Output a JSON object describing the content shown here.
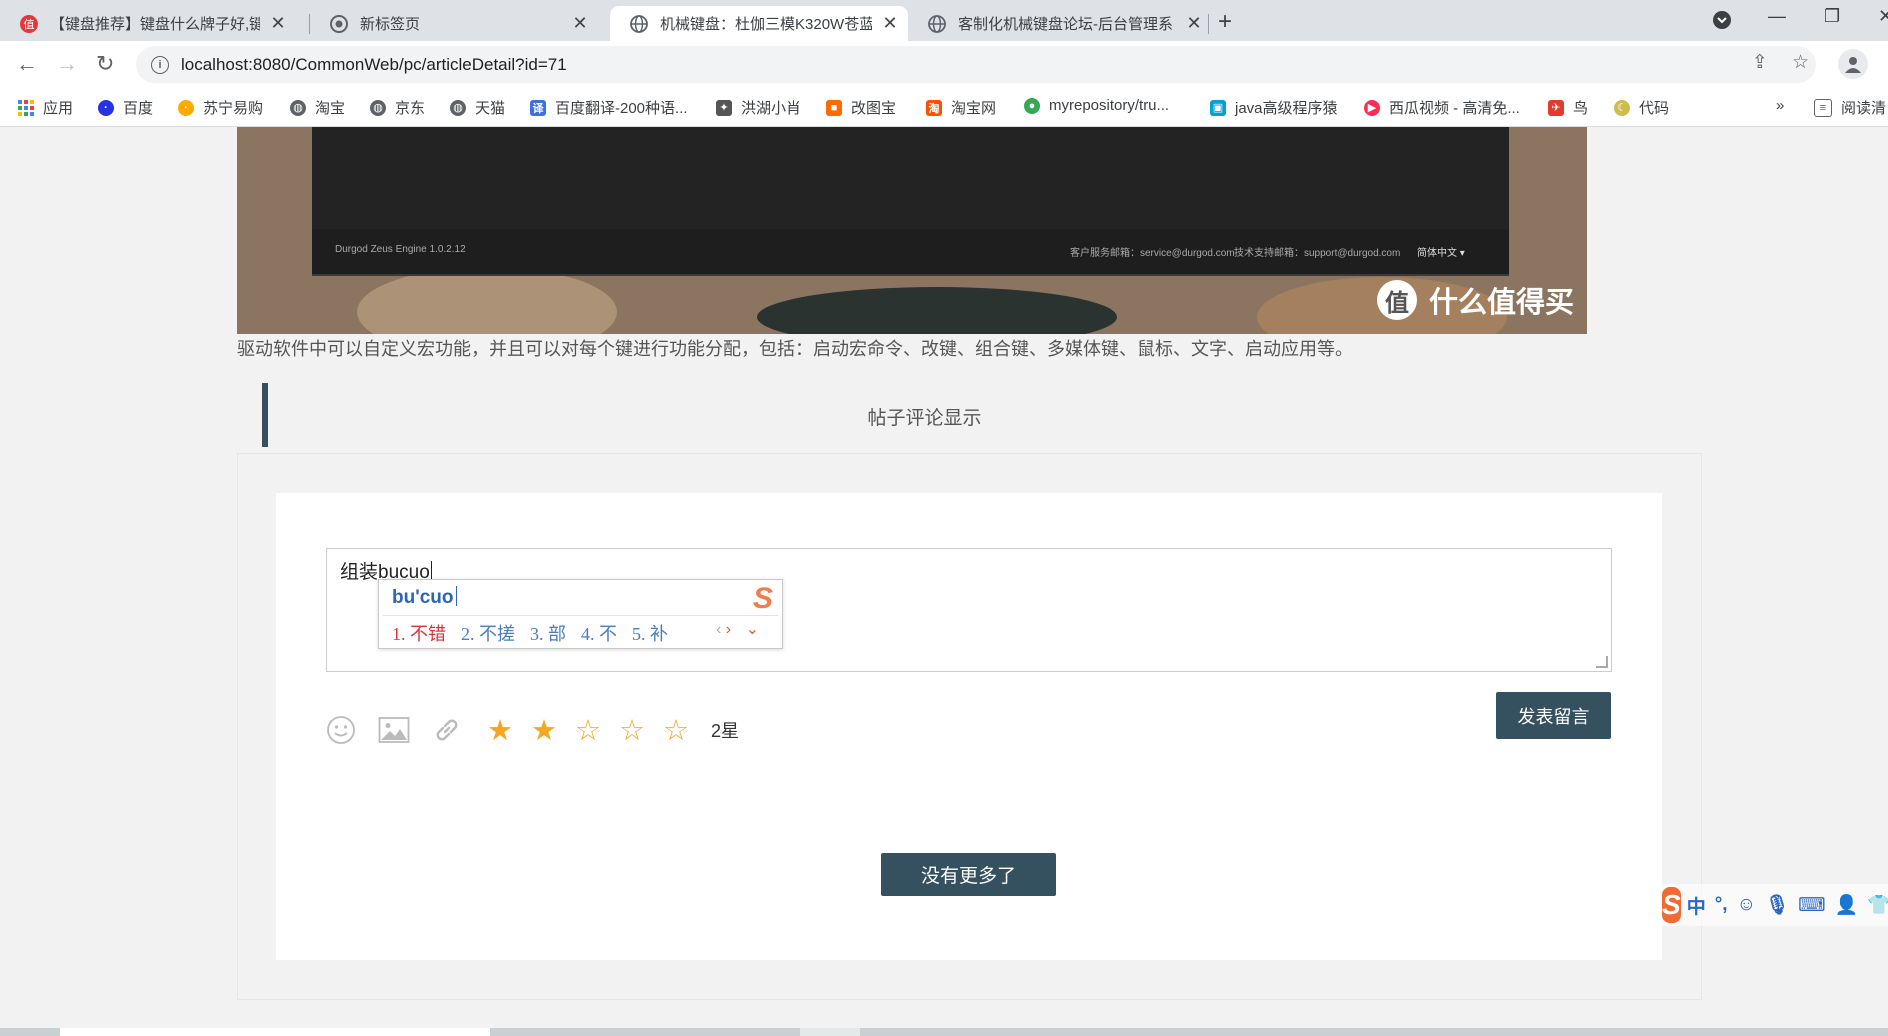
{
  "browser": {
    "tabs": [
      {
        "title": "【键盘推荐】键盘什么牌子好,键盘",
        "favicon": "smzdm-icon",
        "active": false
      },
      {
        "title": "新标签页",
        "favicon": "chrome-icon",
        "active": false
      },
      {
        "title": "机械键盘：杜伽三模K320W苍蓝",
        "favicon": "globe-icon",
        "active": true
      },
      {
        "title": "客制化机械键盘论坛-后台管理系",
        "favicon": "globe-icon",
        "active": false
      }
    ],
    "url": "localhost:8080/CommonWeb/pc/articleDetail?id=71",
    "bookmarks": [
      {
        "label": "应用",
        "icon": "apps-icon",
        "color": "#4285f4"
      },
      {
        "label": "百度",
        "icon": "baidu-icon",
        "color": "#2932e1"
      },
      {
        "label": "苏宁易购",
        "icon": "suning-icon",
        "color": "#ffaa00"
      },
      {
        "label": "淘宝",
        "icon": "globe-icon",
        "color": "#5f6368"
      },
      {
        "label": "京东",
        "icon": "globe-icon",
        "color": "#5f6368"
      },
      {
        "label": "天猫",
        "icon": "globe-icon",
        "color": "#5f6368"
      },
      {
        "label": "百度翻译-200种语...",
        "icon": "translate-icon",
        "color": "#3b6fe4"
      },
      {
        "label": "洪湖小肖",
        "icon": "bee-icon",
        "color": "#555555"
      },
      {
        "label": "改图宝",
        "icon": "gaitubao-icon",
        "color": "#ff6a00"
      },
      {
        "label": "淘宝网",
        "icon": "taobao-icon",
        "color": "#ff5000"
      },
      {
        "label": "myrepository/tru...",
        "icon": "chrome-icon",
        "color": "#34a853"
      },
      {
        "label": "java高级程序猿",
        "icon": "bilibili-icon",
        "color": "#00a1d6"
      },
      {
        "label": "西瓜视频 - 高清免...",
        "icon": "xigua-icon",
        "color": "#fe2c55"
      },
      {
        "label": "鸟",
        "icon": "bird-icon",
        "color": "#e33b2e"
      },
      {
        "label": "代码",
        "icon": "moon-icon",
        "color": "#cdbd4b"
      }
    ],
    "reading_list": "阅读清"
  },
  "article": {
    "image_footer": {
      "engine": "Durgod Zeus Engine 1.0.2.12",
      "service": "客户服务邮箱：service@durgod.com",
      "support": "技术支持邮箱：support@durgod.com",
      "language": "简体中文 ▾"
    },
    "watermark_badge": "值",
    "watermark_text": "什么值得买",
    "description": "驱动软件中可以自定义宏功能，并且可以对每个键进行功能分配，包括：启动宏命令、改键、组合键、多媒体键、鼠标、文字、启动应用等。"
  },
  "comments": {
    "section_title": "帖子评论显示",
    "draft_text": "组装bucuo",
    "ime": {
      "pinyin": "bu'cuo",
      "candidates": [
        "1. 不错",
        "2. 不搓",
        "3. 部",
        "4. 不",
        "5. 补"
      ],
      "logo": "S"
    },
    "stars_filled": 2,
    "stars_total": 5,
    "rating_label": "2星",
    "post_button": "发表留言",
    "no_more_button": "没有更多了"
  },
  "ime_toolbar": {
    "logo": "S",
    "items": [
      "中",
      "°,"
    ]
  },
  "colors": {
    "accent": "#35515f",
    "star": "#f5a623",
    "ime_blue": "#2b67b5",
    "ime_red": "#d9353a"
  }
}
